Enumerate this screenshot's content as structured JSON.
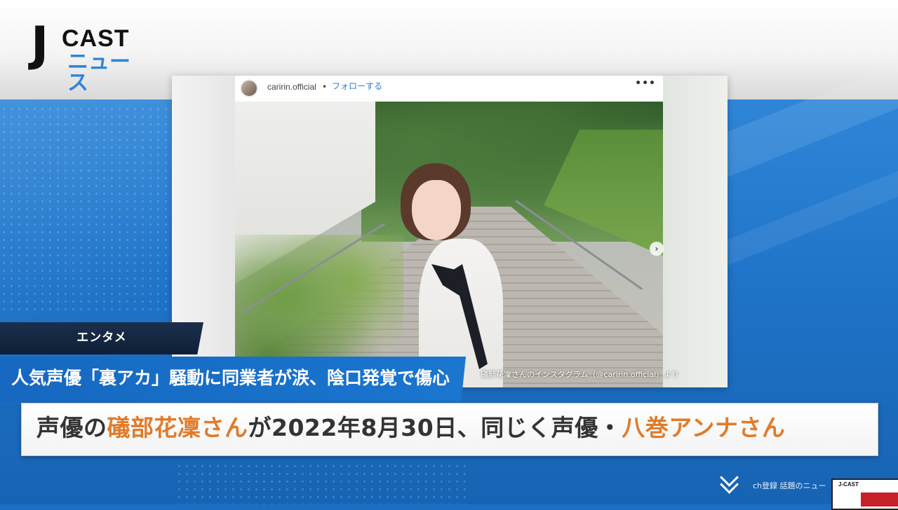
{
  "logo": {
    "j": "J",
    "cast": "CAST",
    "news": "ニュース"
  },
  "post": {
    "username": "caririn.official",
    "separator": "•",
    "follow_label": "フォローする",
    "more_label": "•••",
    "caption": "礒部花凜さんのインスタグラム（@caririn.official）より",
    "next_arrow": "›"
  },
  "category": {
    "label": "エンタメ"
  },
  "headline": {
    "text": "人気声優「裏アカ」騒動に同業者が涙、陰口発覚で傷心"
  },
  "subtitle": {
    "part1": "声優の",
    "name1": "礒部花凜さん",
    "part2": "が2022年8月30日、同じく声優・",
    "name2": "八巻アンナさん"
  },
  "footer": {
    "text": "ch登録 話題のニュー",
    "thumb_logo": "J-CAST"
  },
  "colors": {
    "accent_blue": "#1f74c9",
    "highlight_orange": "#e07b2a",
    "category_navy": "#15263f"
  }
}
